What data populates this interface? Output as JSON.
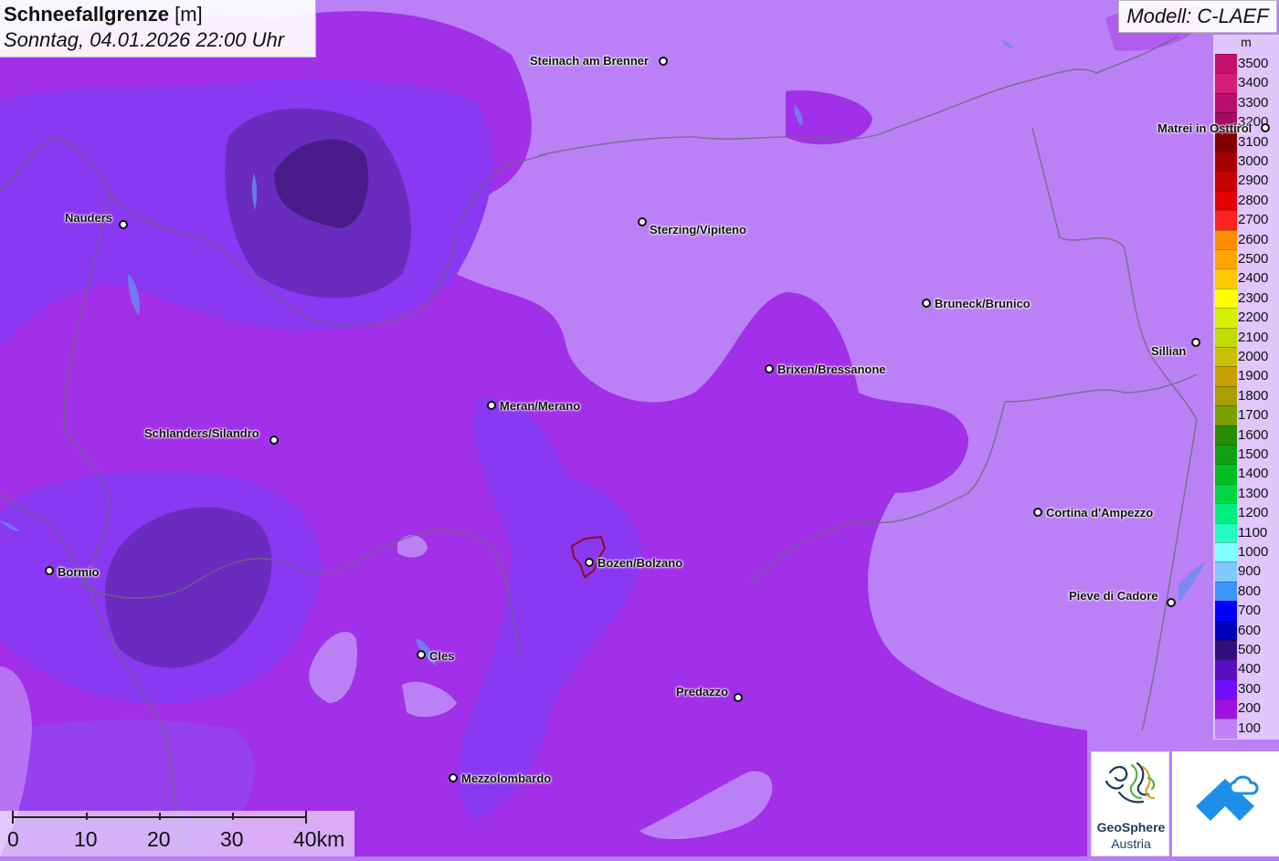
{
  "header": {
    "title_bold": "Schneefallgrenze",
    "title_unit": "[m]",
    "datetime": "Sonntag, 04.01.2026 22:00 Uhr"
  },
  "model_label": "Modell: C-LAEF",
  "legend": {
    "unit": "m",
    "entries": [
      {
        "label": "3500",
        "color": "#c8106a"
      },
      {
        "label": "3400",
        "color": "#d81a78"
      },
      {
        "label": "3300",
        "color": "#b90f6d"
      },
      {
        "label": "3200",
        "color": "#a30c60"
      },
      {
        "label": "3100",
        "color": "#800000"
      },
      {
        "label": "3000",
        "color": "#a60000"
      },
      {
        "label": "2900",
        "color": "#c80000"
      },
      {
        "label": "2800",
        "color": "#e60000"
      },
      {
        "label": "2700",
        "color": "#ff2020"
      },
      {
        "label": "2600",
        "color": "#ff8c00"
      },
      {
        "label": "2500",
        "color": "#ffa500"
      },
      {
        "label": "2400",
        "color": "#ffc800"
      },
      {
        "label": "2300",
        "color": "#ffff00"
      },
      {
        "label": "2200",
        "color": "#d8f000"
      },
      {
        "label": "2100",
        "color": "#c0dc00"
      },
      {
        "label": "2000",
        "color": "#c8c000"
      },
      {
        "label": "1900",
        "color": "#c8a000"
      },
      {
        "label": "1800",
        "color": "#a8a000"
      },
      {
        "label": "1700",
        "color": "#78a000"
      },
      {
        "label": "1600",
        "color": "#288c00"
      },
      {
        "label": "1500",
        "color": "#10a010"
      },
      {
        "label": "1400",
        "color": "#00c020"
      },
      {
        "label": "1300",
        "color": "#00d840"
      },
      {
        "label": "1200",
        "color": "#00f080"
      },
      {
        "label": "1100",
        "color": "#20ffc0"
      },
      {
        "label": "1000",
        "color": "#80ffff"
      },
      {
        "label": "900",
        "color": "#80c8ff"
      },
      {
        "label": "800",
        "color": "#3c96ff"
      },
      {
        "label": "700",
        "color": "#0000ff"
      },
      {
        "label": "600",
        "color": "#0000c0"
      },
      {
        "label": "500",
        "color": "#30107a"
      },
      {
        "label": "400",
        "color": "#5810c0"
      },
      {
        "label": "300",
        "color": "#7010ff"
      },
      {
        "label": "200",
        "color": "#a010e0"
      },
      {
        "label": "100",
        "color": "#c080f8"
      }
    ]
  },
  "cities": [
    {
      "id": "steinach",
      "name": "Steinach am Brenner"
    },
    {
      "id": "matrei",
      "name": "Matrei in Osttirol"
    },
    {
      "id": "nauders",
      "name": "Nauders"
    },
    {
      "id": "sterzing",
      "name": "Sterzing/Vipiteno"
    },
    {
      "id": "bruneck",
      "name": "Bruneck/Brunico"
    },
    {
      "id": "sillian",
      "name": "Sillian"
    },
    {
      "id": "brixen",
      "name": "Brixen/Bressanone"
    },
    {
      "id": "meran",
      "name": "Meran/Merano"
    },
    {
      "id": "schlanders",
      "name": "Schlanders/Silandro"
    },
    {
      "id": "cortina",
      "name": "Cortina d'Ampezzo"
    },
    {
      "id": "bormio",
      "name": "Bormio"
    },
    {
      "id": "bozen",
      "name": "Bozen/Bolzano"
    },
    {
      "id": "pieve",
      "name": "Pieve di Cadore"
    },
    {
      "id": "cles",
      "name": "Cles"
    },
    {
      "id": "predazzo",
      "name": "Predazzo"
    },
    {
      "id": "mezzolombardo",
      "name": "Mezzolombardo"
    }
  ],
  "scale": {
    "labels": [
      "0",
      "10",
      "20",
      "30",
      "40km"
    ]
  },
  "logos": {
    "geosphere_line1": "GeoSphere",
    "geosphere_line2": "Austria"
  }
}
